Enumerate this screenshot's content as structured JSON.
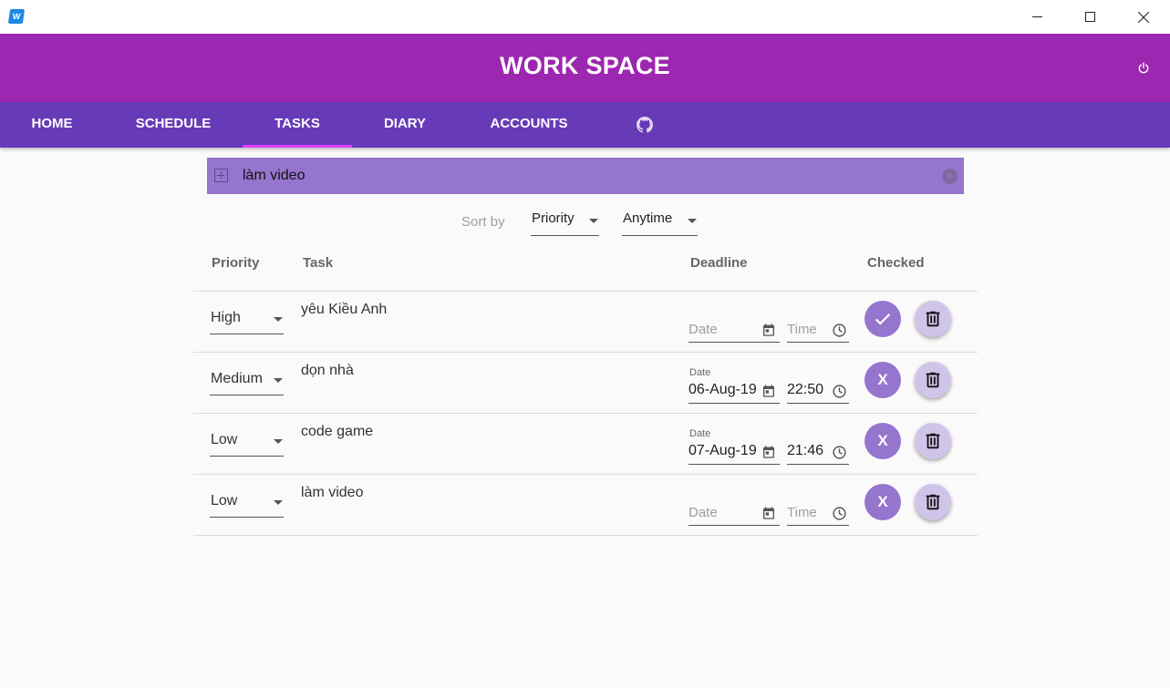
{
  "window": {
    "icon": "app-icon",
    "minimize_icon": "minimize-icon",
    "maximize_icon": "maximize-icon",
    "close_icon": "close-icon"
  },
  "header": {
    "title": "WORK SPACE",
    "background": "#9c27b0",
    "power_icon": "power-icon"
  },
  "tabs": {
    "background": "#673ab7",
    "indicator_color": "#e040fb",
    "items": [
      {
        "label": "HOME"
      },
      {
        "label": "SCHEDULE"
      },
      {
        "label": "TASKS",
        "active": true
      },
      {
        "label": "DIARY"
      },
      {
        "label": "ACCOUNTS"
      },
      {
        "label": "",
        "icon": "github-icon"
      }
    ]
  },
  "add_task": {
    "value": "làm video",
    "background": "#9575cd",
    "add_icon": "add-box-icon",
    "clear_icon": "clear-icon"
  },
  "sort": {
    "label": "Sort by",
    "by": "Priority",
    "range": "Anytime"
  },
  "table": {
    "headers": {
      "priority": "Priority",
      "task": "Task",
      "deadline": "Deadline",
      "checked": "Checked"
    },
    "date_label": "Date",
    "time_label": "Time",
    "rows": [
      {
        "priority": "High",
        "task": "yêu Kiều Anh",
        "date": "",
        "time": "",
        "checked": true
      },
      {
        "priority": "Medium",
        "task": "dọn nhà",
        "date": "06-Aug-19",
        "time": "22:50",
        "checked": false
      },
      {
        "priority": "Low",
        "task": "code game",
        "date": "07-Aug-19",
        "time": "21:46",
        "checked": false
      },
      {
        "priority": "Low",
        "task": "làm video",
        "date": "",
        "time": "",
        "checked": false
      }
    ],
    "unchecked_label": "X",
    "accent": "#9575cd",
    "delete_icon": "trash-icon"
  }
}
